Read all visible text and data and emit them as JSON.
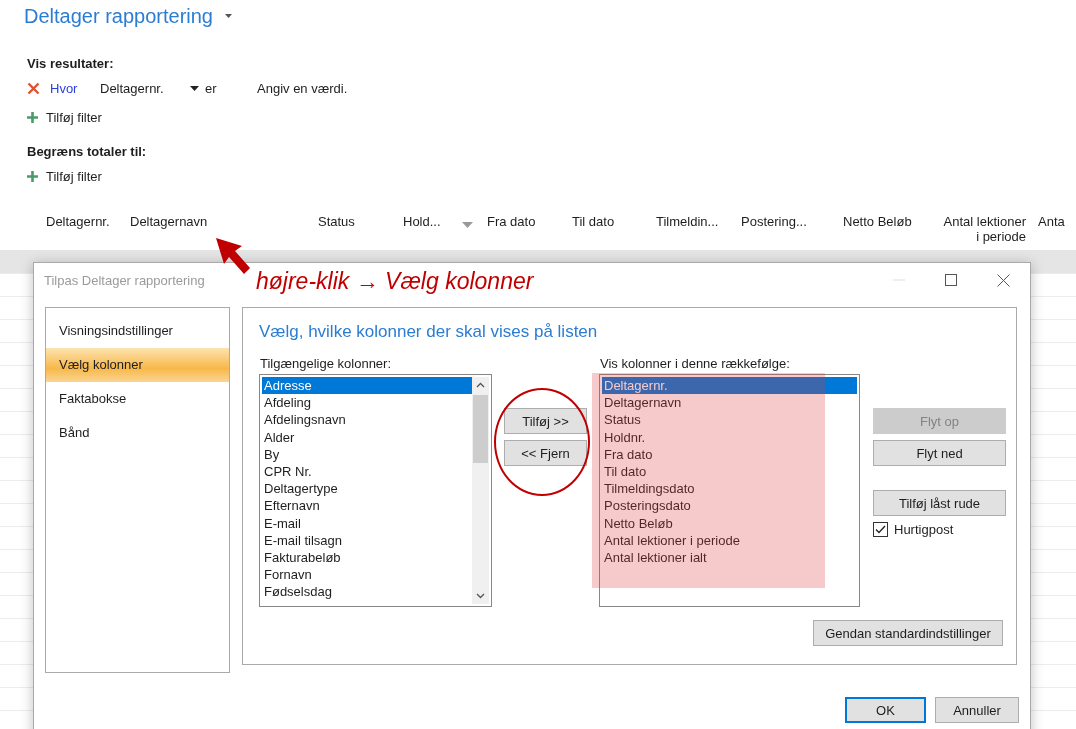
{
  "page": {
    "title": "Deltager rapportering"
  },
  "results_filter": {
    "heading": "Vis resultater:",
    "condition": {
      "link": "Hvor",
      "field": "Deltagernr.",
      "operator": "er",
      "placeholder": "Angiv en værdi."
    },
    "add_filter": "Tilføj filter"
  },
  "totals_filter": {
    "heading": "Begræns totaler til:",
    "add_filter": "Tilføj filter"
  },
  "table": {
    "columns": [
      {
        "label": "Deltagernr.",
        "sorted": false
      },
      {
        "label": "Deltagernavn",
        "sorted": false
      },
      {
        "label": "Status",
        "sorted": false
      },
      {
        "label": "Hold...",
        "sorted": true
      },
      {
        "label": "Fra dato",
        "sorted": false
      },
      {
        "label": "Til dato",
        "sorted": false
      },
      {
        "label": "Tilmeldin...",
        "sorted": false
      },
      {
        "label": "Postering...",
        "sorted": false
      },
      {
        "label": "Netto Beløb",
        "sorted": false
      },
      {
        "label": "Antal lektioner i periode",
        "sorted": false
      },
      {
        "label": "Anta",
        "sorted": false
      }
    ]
  },
  "annotation": {
    "text": "højre-klik → Vælg kolonner"
  },
  "dialog": {
    "title": "Tilpas Deltager rapportering",
    "nav": [
      {
        "label": "Visningsindstillinger",
        "selected": false
      },
      {
        "label": "Vælg kolonner",
        "selected": true
      },
      {
        "label": "Faktabokse",
        "selected": false
      },
      {
        "label": "Bånd",
        "selected": false
      }
    ],
    "heading": "Vælg, hvilke kolonner der skal vises på listen",
    "available": {
      "label": "Tilgængelige kolonner:",
      "items": [
        {
          "label": "Adresse",
          "selected": true
        },
        {
          "label": "Afdeling",
          "selected": false
        },
        {
          "label": "Afdelingsnavn",
          "selected": false
        },
        {
          "label": "Alder",
          "selected": false
        },
        {
          "label": "By",
          "selected": false
        },
        {
          "label": "CPR Nr.",
          "selected": false
        },
        {
          "label": "Deltagertype",
          "selected": false
        },
        {
          "label": "Efternavn",
          "selected": false
        },
        {
          "label": "E-mail",
          "selected": false
        },
        {
          "label": "E-mail tilsagn",
          "selected": false
        },
        {
          "label": "Fakturabeløb",
          "selected": false
        },
        {
          "label": "Fornavn",
          "selected": false
        },
        {
          "label": "Fødselsdag",
          "selected": false
        }
      ]
    },
    "add_button": "Tilføj >>",
    "remove_button": "<< Fjern",
    "shown": {
      "label": "Vis kolonner i denne rækkefølge:",
      "items": [
        {
          "label": "Deltagernr.",
          "selected": true
        },
        {
          "label": "Deltagernavn",
          "selected": false
        },
        {
          "label": "Status",
          "selected": false
        },
        {
          "label": "Holdnr.",
          "selected": false
        },
        {
          "label": "Fra dato",
          "selected": false
        },
        {
          "label": "Til dato",
          "selected": false
        },
        {
          "label": "Tilmeldingsdato",
          "selected": false
        },
        {
          "label": "Posteringsdato",
          "selected": false
        },
        {
          "label": "Netto Beløb",
          "selected": false
        },
        {
          "label": "Antal lektioner i periode",
          "selected": false
        },
        {
          "label": "Antal lektioner ialt",
          "selected": false
        }
      ]
    },
    "side_buttons": [
      {
        "label": "Flyt op",
        "disabled": true
      },
      {
        "label": "Flyt ned",
        "disabled": false
      },
      {
        "label": "Tilføj låst rude",
        "disabled": false
      }
    ],
    "quickpost": {
      "label": "Hurtigpost",
      "checked": true
    },
    "restore_button": "Gendan standardindstillinger",
    "ok_button": "OK",
    "cancel_button": "Annuller"
  }
}
